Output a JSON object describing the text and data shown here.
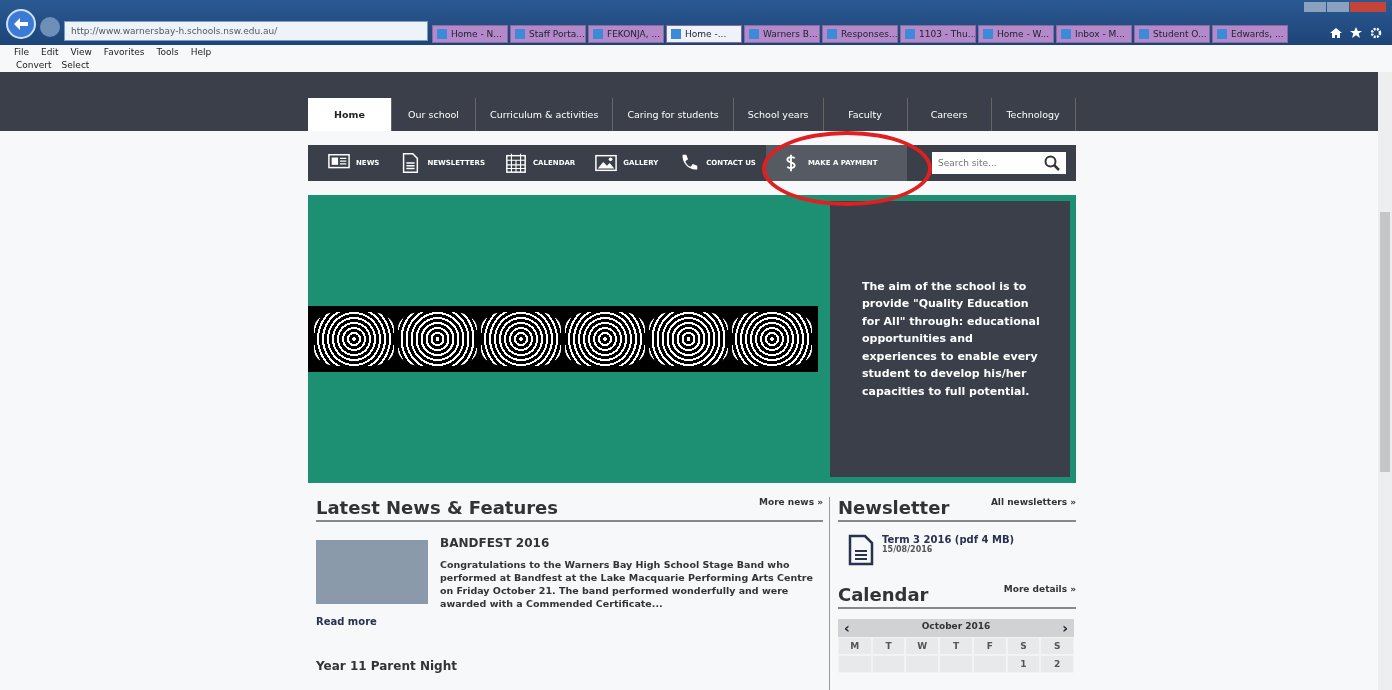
{
  "browser": {
    "address": "http://www.warnersbay-h.schools.nsw.edu.au/",
    "tabs": [
      {
        "label": "Home - N...",
        "selected": false
      },
      {
        "label": "Staff Porta...",
        "selected": false
      },
      {
        "label": "FEKONJA, ...",
        "selected": false
      },
      {
        "label": "Home -...",
        "selected": true
      },
      {
        "label": "Warners B...",
        "selected": false
      },
      {
        "label": "Responses...",
        "selected": false
      },
      {
        "label": "1103 - Thu...",
        "selected": false
      },
      {
        "label": "Home - W...",
        "selected": false
      },
      {
        "label": "Inbox - M...",
        "selected": false
      },
      {
        "label": "Student O...",
        "selected": false
      },
      {
        "label": "Edwards, ...",
        "selected": false
      }
    ],
    "menu": [
      "File",
      "Edit",
      "View",
      "Favorites",
      "Tools",
      "Help"
    ],
    "commands": [
      "Convert",
      "Select"
    ]
  },
  "nav": [
    {
      "label": "Home",
      "selected": true
    },
    {
      "label": "Our school",
      "selected": false
    },
    {
      "label": "Curriculum & activities",
      "selected": false
    },
    {
      "label": "Caring for students",
      "selected": false
    },
    {
      "label": "School years",
      "selected": false
    },
    {
      "label": "Faculty",
      "selected": false
    },
    {
      "label": "Careers",
      "selected": false
    },
    {
      "label": "Technology",
      "selected": false
    }
  ],
  "subnav": [
    {
      "kind": "news",
      "label": "NEWS",
      "highlighted": false
    },
    {
      "kind": "newsletters",
      "label": "NEWSLETTERS",
      "highlighted": false
    },
    {
      "kind": "calendar",
      "label": "CALENDAR",
      "highlighted": false
    },
    {
      "kind": "gallery",
      "label": "GALLERY",
      "highlighted": false
    },
    {
      "kind": "contact",
      "label": "CONTACT US",
      "highlighted": false
    },
    {
      "kind": "payment",
      "label": "MAKE A PAYMENT",
      "highlighted": true
    }
  ],
  "search": {
    "placeholder": "Search site..."
  },
  "hero": {
    "aim": "The aim of the school is to provide \"Quality Education for All\" through: educational opportunities and experiences to enable every student to develop his/her capacities to full potential."
  },
  "news": {
    "title": "Latest News & Features",
    "more": "More news »",
    "items": [
      {
        "title": "BANDFEST 2016",
        "body": "Congratulations to the Warners Bay High School Stage Band who performed at Bandfest at the Lake Macquarie Performing Arts Centre on Friday October 21. The band performed wonderfully and were awarded with a Commended Certificate...",
        "read_more": "Read more"
      }
    ],
    "next_title": "Year 11 Parent Night"
  },
  "newsletter": {
    "title": "Newsletter",
    "more": "All newsletters »",
    "items": [
      {
        "title": "Term 3 2016 (pdf 4 MB)",
        "date": "15/08/2016"
      }
    ]
  },
  "calendar": {
    "title": "Calendar",
    "more": "More details »",
    "prev": "‹",
    "next": "›",
    "month": "October 2016",
    "weekdays": [
      "M",
      "T",
      "W",
      "T",
      "F",
      "S",
      "S"
    ],
    "first_row": [
      "1",
      "2"
    ]
  }
}
